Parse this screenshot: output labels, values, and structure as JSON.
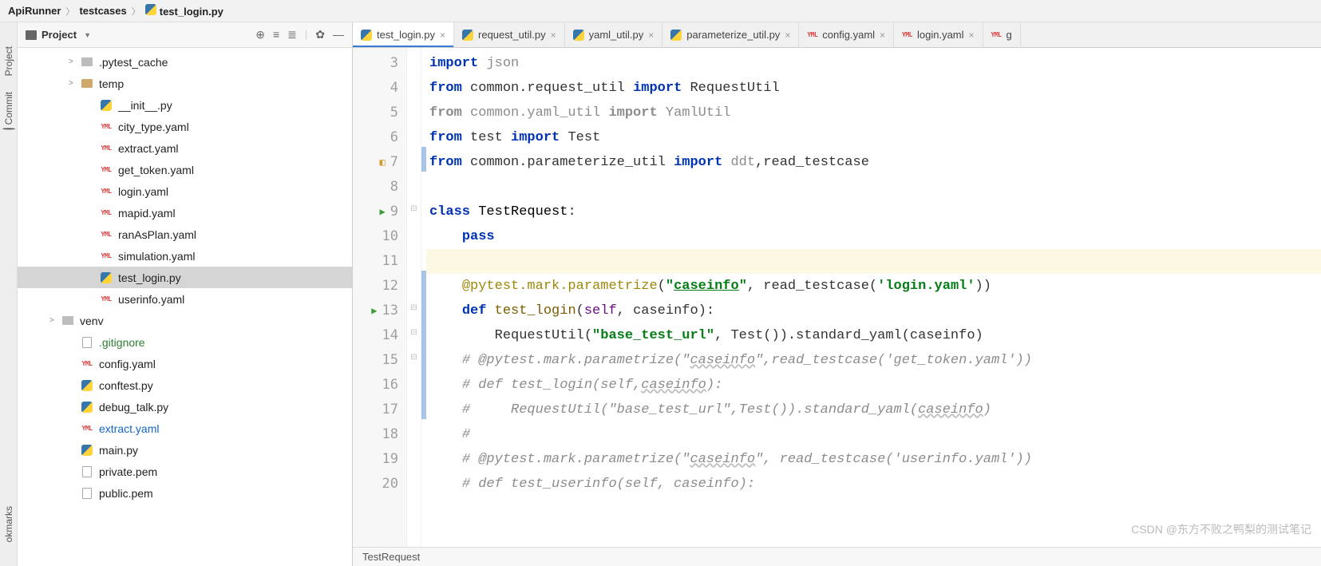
{
  "breadcrumb": [
    {
      "label": "ApiRunner"
    },
    {
      "label": "testcases"
    },
    {
      "label": "test_login.py",
      "icon": "py"
    }
  ],
  "sideStrip": {
    "top": "Project",
    "mid": "Commit",
    "bottom": "okmarks"
  },
  "projectHeader": {
    "title": "Project"
  },
  "tree": [
    {
      "depth": 1,
      "chev": ">",
      "icon": "folder-muted",
      "label": ".pytest_cache"
    },
    {
      "depth": 1,
      "chev": ">",
      "icon": "folder",
      "label": "temp"
    },
    {
      "depth": 2,
      "icon": "py",
      "label": "__init__.py"
    },
    {
      "depth": 2,
      "icon": "yml",
      "label": "city_type.yaml"
    },
    {
      "depth": 2,
      "icon": "yml",
      "label": "extract.yaml"
    },
    {
      "depth": 2,
      "icon": "yml",
      "label": "get_token.yaml"
    },
    {
      "depth": 2,
      "icon": "yml",
      "label": "login.yaml"
    },
    {
      "depth": 2,
      "icon": "yml",
      "label": "mapid.yaml"
    },
    {
      "depth": 2,
      "icon": "yml",
      "label": "ranAsPlan.yaml"
    },
    {
      "depth": 2,
      "icon": "yml",
      "label": "simulation.yaml"
    },
    {
      "depth": 2,
      "icon": "py",
      "label": "test_login.py",
      "selected": true
    },
    {
      "depth": 2,
      "icon": "yml",
      "label": "userinfo.yaml"
    },
    {
      "depth": 0,
      "chev": ">",
      "icon": "folder-muted",
      "label": "venv"
    },
    {
      "depth": 1,
      "icon": "file",
      "label": ".gitignore",
      "cls": "green"
    },
    {
      "depth": 1,
      "icon": "yml",
      "label": "config.yaml"
    },
    {
      "depth": 1,
      "icon": "py",
      "label": "conftest.py"
    },
    {
      "depth": 1,
      "icon": "py",
      "label": "debug_talk.py"
    },
    {
      "depth": 1,
      "icon": "yml",
      "label": "extract.yaml",
      "cls": "blue"
    },
    {
      "depth": 1,
      "icon": "py",
      "label": "main.py"
    },
    {
      "depth": 1,
      "icon": "file",
      "label": "private.pem"
    },
    {
      "depth": 1,
      "icon": "file",
      "label": "public.pem"
    }
  ],
  "tabs": [
    {
      "label": "test_login.py",
      "icon": "py",
      "active": true
    },
    {
      "label": "request_util.py",
      "icon": "py"
    },
    {
      "label": "yaml_util.py",
      "icon": "py"
    },
    {
      "label": "parameterize_util.py",
      "icon": "py"
    },
    {
      "label": "config.yaml",
      "icon": "yml"
    },
    {
      "label": "login.yaml",
      "icon": "yml"
    },
    {
      "label": "g",
      "icon": "yml",
      "trunc": true
    }
  ],
  "chart_data": null,
  "code": {
    "startLine": 3,
    "lines": [
      {
        "n": 3,
        "html": "<span class='kw'>import</span> <span class='gray'>json</span>"
      },
      {
        "n": 4,
        "html": "<span class='kw'>from</span> common.request_util <span class='kw'>import</span> RequestUtil"
      },
      {
        "n": 5,
        "html": "<span class='gray'><span class='kw' style='color:#8c8c8c'>from</span> common.yaml_util <span class='kw' style='color:#8c8c8c'>import</span> YamlUtil</span>"
      },
      {
        "n": 6,
        "html": "<span class='kw'>from</span> test <span class='kw'>import</span> Test"
      },
      {
        "n": 7,
        "bookmark": true,
        "modified": true,
        "html": "<span class='kw'>from</span> common.parameterize_util <span class='kw'>import</span> <span class='gray'>ddt</span>,read_testcase"
      },
      {
        "n": 8,
        "html": ""
      },
      {
        "n": 9,
        "run": true,
        "fold": "-",
        "html": "<span class='kw'>class</span> <span class='cls'>TestRequest</span>:"
      },
      {
        "n": 10,
        "html": "    <span class='kw'>pass</span>"
      },
      {
        "n": 11,
        "current": true,
        "html": ""
      },
      {
        "n": 12,
        "modified": true,
        "html": "    <span class='deco'>@pytest.mark.parametrize</span>(<span class='str'>\"</span><span class='str' style='text-decoration:underline'>caseinfo</span><span class='str'>\"</span>, read_testcase(<span class='str'>'login.yaml'</span>))"
      },
      {
        "n": 13,
        "run": true,
        "fold": "-",
        "modified": true,
        "html": "    <span class='kw'>def</span> <span class='fn'>test_login</span>(<span class='param'>self</span>, caseinfo):"
      },
      {
        "n": 14,
        "fold": "-",
        "modified": true,
        "html": "        RequestUtil(<span class='str'>\"base_test_url\"</span>, Test()).standard_yaml(caseinfo)"
      },
      {
        "n": 15,
        "fold": "-",
        "modified": true,
        "html": "    <span class='cmt'># @pytest.mark.parametrize(\"<span class='cmt-u'>caseinfo</span>\",read_testcase('get_token.yaml'))</span>"
      },
      {
        "n": 16,
        "modified": true,
        "html": "    <span class='cmt'># def test_login(self,<span class='cmt-u'>caseinfo</span>):</span>"
      },
      {
        "n": 17,
        "modified": true,
        "html": "    <span class='cmt'>#     RequestUtil(\"base_test_url\",Test()).standard_yaml(<span class='cmt-u'>caseinfo</span>)</span>"
      },
      {
        "n": 18,
        "html": "    <span class='cmt'>#</span>"
      },
      {
        "n": 19,
        "html": "    <span class='cmt'># @pytest.mark.parametrize(\"<span class='cmt-u'>caseinfo</span>\", read_testcase('userinfo.yaml'))</span>"
      },
      {
        "n": 20,
        "html": "    <span class='cmt'># def test_userinfo(self, caseinfo):</span>"
      }
    ]
  },
  "status": {
    "context": "TestRequest"
  },
  "watermark": "CSDN @东方不败之鸭梨的测试笔记"
}
